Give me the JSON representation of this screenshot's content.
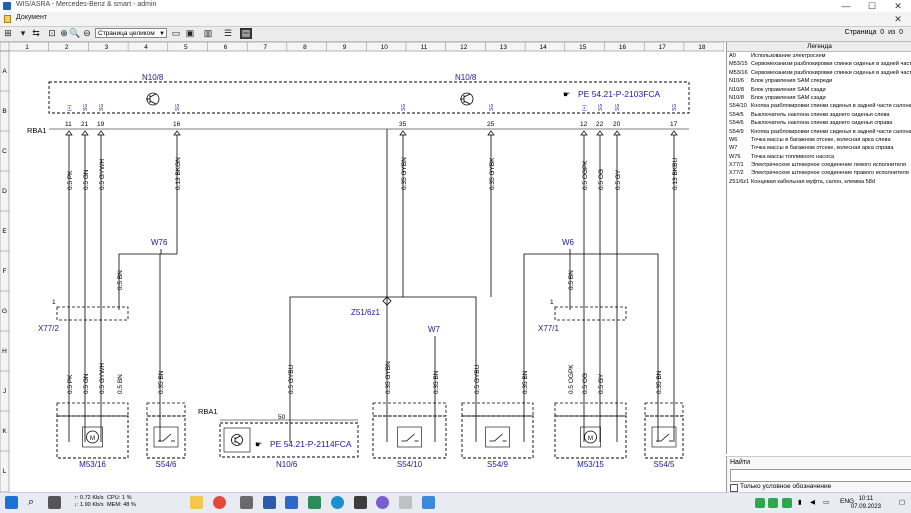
{
  "window": {
    "title": "WIS/ASRA - Mercedes-Benz & smart - admin",
    "minimize": "—",
    "maximize": "☐",
    "close": "✕"
  },
  "document": {
    "title": "Документ",
    "close": "✕"
  },
  "toolbar": {
    "zoom_select": "Страница целиком",
    "page_label": "Страница",
    "page_current": "0",
    "page_of": "из",
    "page_total": "0"
  },
  "diagram": {
    "columns": [
      "1",
      "2",
      "3",
      "4",
      "5",
      "6",
      "7",
      "8",
      "9",
      "10",
      "11",
      "12",
      "13",
      "14",
      "15",
      "16",
      "17",
      "18"
    ],
    "rows": [
      "A",
      "B",
      "C",
      "D",
      "E",
      "F",
      "G",
      "H",
      "J",
      "K",
      "L"
    ],
    "n10_8_label": "N10/8",
    "n10_8_ref": "PE 54.21-P-2103FCA",
    "rba1": "RBA1",
    "pins_top": [
      "11",
      "21",
      "19",
      "16",
      "35",
      "25",
      "12",
      "22",
      "20",
      "17"
    ],
    "pin_codes": [
      "(+)",
      "SG",
      "SG",
      "SG",
      "SG",
      "SG",
      "(+)",
      "SG",
      "SG",
      "SG"
    ],
    "wires_top": [
      "0.5 PK",
      "0.5 GN",
      "0.5 GYWH",
      "0.13 BKGN",
      "0.35 GYBN",
      "0.35 GYBK",
      "0.5 OGPK",
      "0.5 OG",
      "0.5 GY",
      "0.13 BKBU"
    ],
    "w76": "W76",
    "w6": "W6",
    "w7": "W7",
    "z51": "Z51/6z1",
    "x77_2": "X77/2",
    "x77_1": "X77/1",
    "wires_bottom": [
      "0.5 PK",
      "0.5 GN",
      "0.5 GYWH",
      "0.5 BN",
      "0.35 BN",
      "0.5 GYBU",
      "0.35 GYBN",
      "0.35 BN",
      "0.5 GYBU",
      "0.35 BN",
      "0.5 OGPK",
      "0.5 OG",
      "0.5 GY",
      "0.35 BN"
    ],
    "wire_bn_w76": "0.5 BN",
    "wire_bn_w6": "0.5 BN",
    "n10_6_label": "N10/6",
    "n10_6_ref": "PE 54.21-P-2114FCA",
    "n10_6_pin": "50",
    "components": [
      "M53/16",
      "S54/6",
      "S54/10",
      "S54/9",
      "M53/15",
      "S54/5"
    ]
  },
  "legend": {
    "header": "Легенда",
    "rows": [
      {
        "code": "A0",
        "text": "Использование электросхем"
      },
      {
        "code": "M53/15",
        "text": "Сервомеханизм разблокировки спинки сиденья в задней части слева"
      },
      {
        "code": "M53/16",
        "text": "Сервомеханизм разблокировки спинки сиденья в задней части справа"
      },
      {
        "code": "N10/6",
        "text": "Блок управления SAM спереди"
      },
      {
        "code": "N10/8",
        "text": "Блок управления SAM сзади"
      },
      {
        "code": "N10/8",
        "text": "Блок управления SAM сзади"
      },
      {
        "code": "S54/10",
        "text": "Кнопка разблокировки спинки сиденья в задней части салона"
      },
      {
        "code": "S54/5",
        "text": "Выключатель наклона спинки заднего сиденья слева"
      },
      {
        "code": "S54/6",
        "text": "Выключатель наклона спинки заднего сиденья справа"
      },
      {
        "code": "S54/9",
        "text": "Кнопка разблокировки спинки сиденья в задней части салона"
      },
      {
        "code": "W6",
        "text": "Точка массы в багажном отсеке, колесная арка слева"
      },
      {
        "code": "W7",
        "text": "Точка массы в багажном отсеке, колесная арка справа"
      },
      {
        "code": "W76",
        "text": "Точка массы топливного насоса"
      },
      {
        "code": "X77/1",
        "text": "Электрическое штекерное соединение левого исполнителя"
      },
      {
        "code": "X77/2",
        "text": "Электрическое штекерное соединение правого исполнителя"
      },
      {
        "code": "Z51/6z1",
        "text": "Концевая кабельная муфта, салон, клемма 58d"
      }
    ]
  },
  "search": {
    "label": "Найти",
    "placeholder": "",
    "checkbox_label": "Только условное обозначение"
  },
  "taskbar": {
    "net_up": "↑: 0.72 Kb/s",
    "net_down": "↓: 1.90 Kb/s",
    "cpu": "CPU: 1 %",
    "mem": "MEM: 48 %",
    "lang": "ENG",
    "time": "10:11",
    "date": "07.09.2023"
  }
}
